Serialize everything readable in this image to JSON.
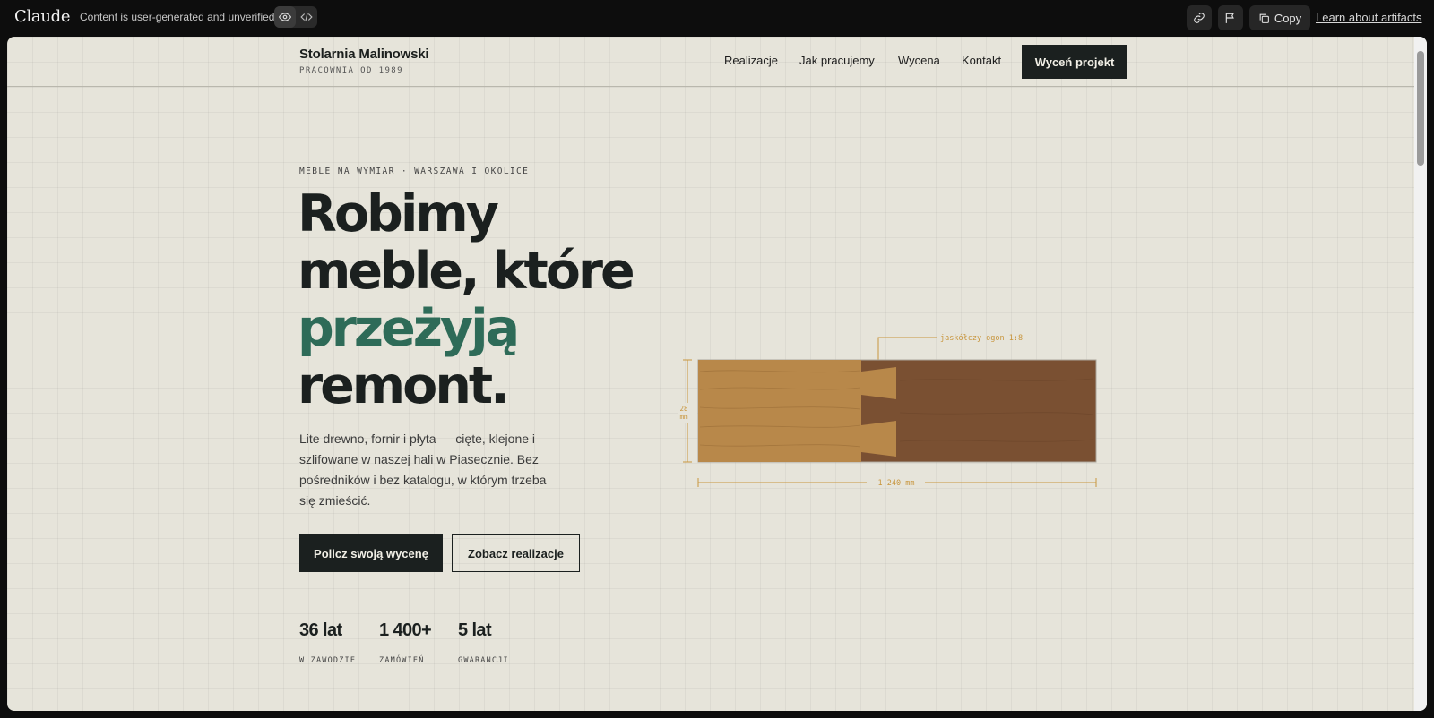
{
  "app": {
    "brand": "Claude",
    "disclaimer": "Content is user-generated and unverified.",
    "copy_label": "Copy",
    "learn_label": "Learn about artifacts"
  },
  "site": {
    "logo_name": "Stolarnia Malinowski",
    "logo_sub": "PRACOWNIA OD 1989",
    "nav": [
      "Realizacje",
      "Jak pracujemy",
      "Wycena",
      "Kontakt"
    ],
    "nav_cta": "Wyceń projekt"
  },
  "hero": {
    "eyebrow": "MEBLE NA WYMIAR · WARSZAWA I OKOLICE",
    "title_line1": "Robimy",
    "title_line2": "meble, które",
    "title_accent": "przeżyją",
    "title_line4": "remont.",
    "lead": "Lite drewno, fornir i płyta — cięte, klejone i szlifowane w naszej hali w Piasecznie. Bez pośredników i bez katalogu, w którym trzeba się zmieścić.",
    "primary_cta": "Policz swoją wycenę",
    "secondary_cta": "Zobacz realizacje",
    "stats": [
      {
        "value": "36 lat",
        "label": "W ZAWODZIE"
      },
      {
        "value": "1 400+",
        "label": "ZAMÓWIEŃ"
      },
      {
        "value": "5 lat",
        "label": "GWARANCJI"
      }
    ]
  },
  "drawing": {
    "annotation": "jaskółczy ogon 1:8",
    "height_value": "28",
    "height_unit": "mm",
    "width_label": "1 240 mm"
  },
  "colors": {
    "background": "#e6e4da",
    "ink": "#1b201f",
    "accent_green": "#2e6b58",
    "wood_light": "#b8884a",
    "wood_dark": "#7a5032",
    "dimension": "#c8963e"
  }
}
